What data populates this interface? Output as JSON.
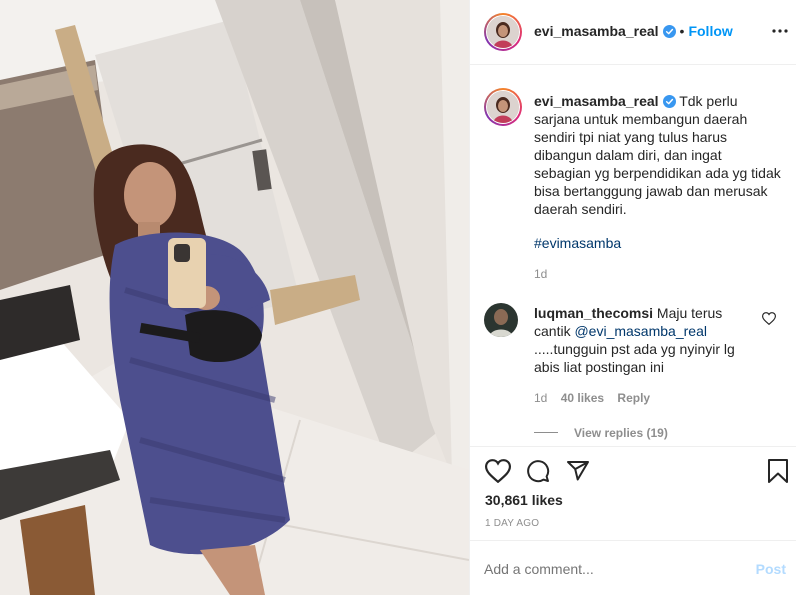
{
  "post": {
    "username": "evi_masamba_real",
    "follow_label": "Follow",
    "dot": "•"
  },
  "caption": {
    "username": "evi_masamba_real",
    "text": "Tdk perlu sarjana untuk membangun daerah sendiri tpi niat yang tulus harus dibangun dalam diri, dan ingat sebagian yg berpendidikan ada yg tidak bisa bertanggung jawab dan merusak daerah sendiri.",
    "hashtag": "#evimasamba",
    "time": "1d"
  },
  "comment": {
    "username": "luqman_thecomsi",
    "text_before_mention": "Maju terus cantik ",
    "mention": "@evi_masamba_real",
    "text_after_mention": " .....tungguin pst ada yg nyinyir lg abis liat postingan ini",
    "time": "1d",
    "likes": "40 likes",
    "reply_label": "Reply",
    "view_replies": "View replies (19)"
  },
  "stats": {
    "likes": "30,861 likes",
    "date": "1 DAY AGO"
  },
  "add_comment": {
    "placeholder": "Add a comment...",
    "post_label": "Post"
  },
  "colors": {
    "accent": "#0095f6",
    "muted": "#8e8e8e",
    "post_disabled": "#b3dbff",
    "hashtag": "#00376b"
  },
  "icons": [
    "verified-badge-icon",
    "more-options-icon",
    "heart-icon",
    "comment-icon",
    "share-icon",
    "bookmark-icon",
    "comment-like-heart-icon"
  ]
}
